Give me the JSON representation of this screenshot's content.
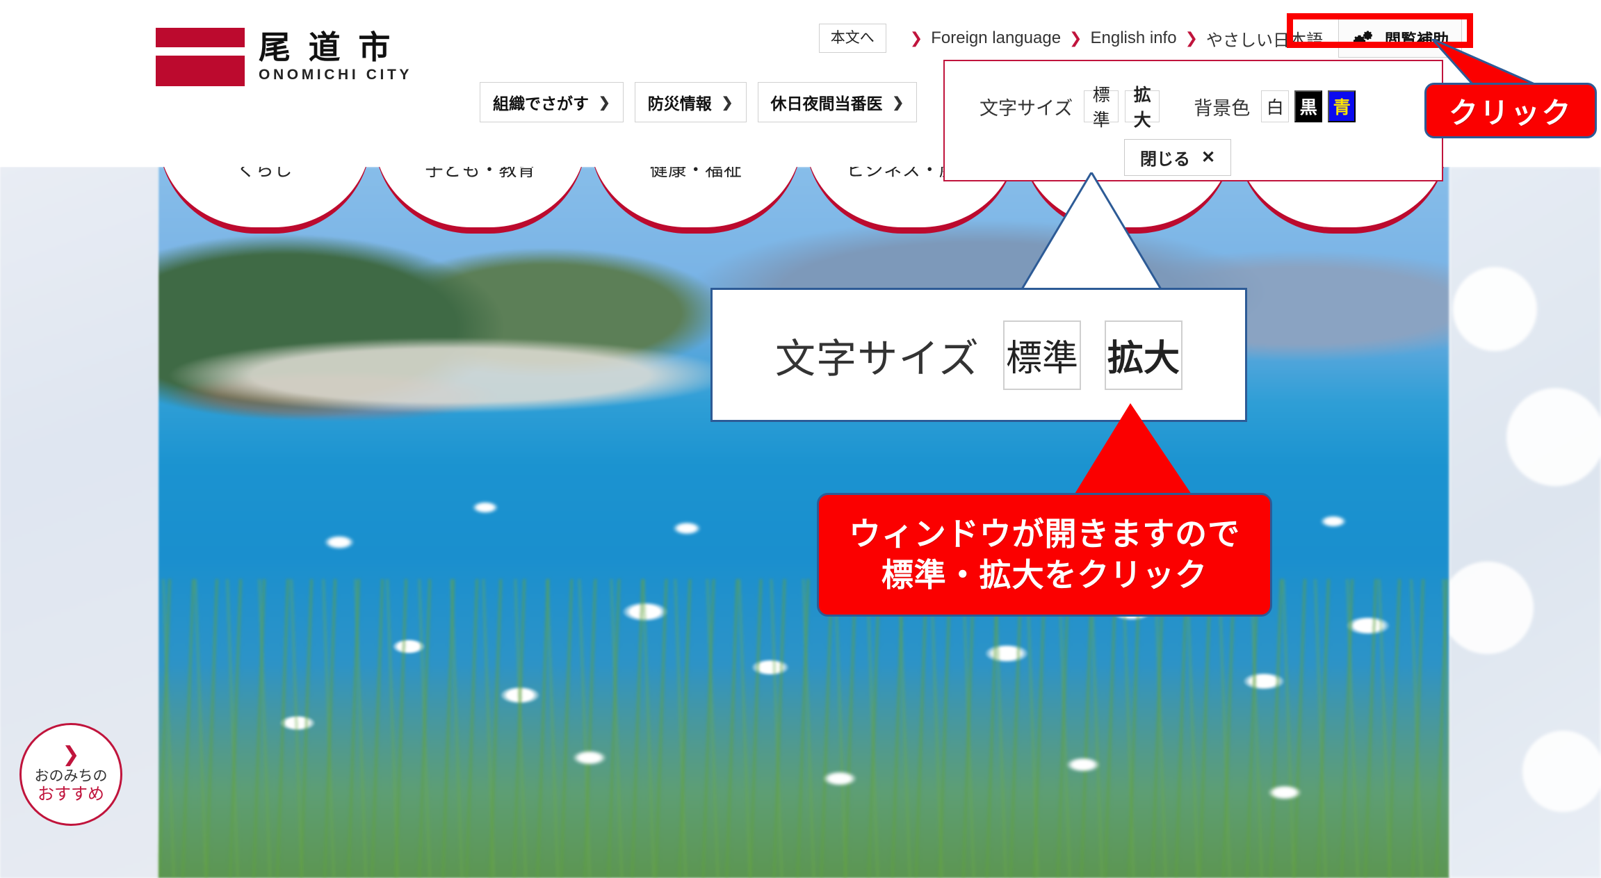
{
  "site": {
    "logo_jp": "尾 道 市",
    "logo_en": "ONOMICHI CITY"
  },
  "header": {
    "skip_link": "本文へ",
    "lang_links": [
      {
        "label": "Foreign language",
        "chevron": "❯"
      },
      {
        "label": "English info",
        "chevron": "❯"
      },
      {
        "label": "やさしい日本語",
        "chevron": "❯"
      }
    ],
    "accessibility_button": {
      "label": "閲覧補助",
      "icon": "double-gear-icon"
    },
    "sub_nav": [
      {
        "label": "組織でさがす",
        "chevron": "❯"
      },
      {
        "label": "防災情報",
        "chevron": "❯"
      },
      {
        "label": "休日夜間当番医",
        "chevron": "❯"
      }
    ]
  },
  "category_nav": [
    {
      "label": "くらし",
      "icon": "house-icon"
    },
    {
      "label": "子ども・教育",
      "icon": "parent-child-icon"
    },
    {
      "label": "健康・福祉",
      "icon": "heart-hand-icon"
    },
    {
      "label": "ビジネス・産業",
      "icon": "briefcase-icon"
    },
    {
      "label": "",
      "icon": ""
    },
    {
      "label": "",
      "icon": ""
    }
  ],
  "accessibility_panel": {
    "font_size_label": "文字サイズ",
    "font_size_options": [
      {
        "label": "標準",
        "selected": false
      },
      {
        "label": "拡大",
        "selected": true
      }
    ],
    "background_label": "背景色",
    "background_options": [
      {
        "label": "白",
        "bg": "#ffffff",
        "fg": "#222222"
      },
      {
        "label": "黒",
        "bg": "#000000",
        "fg": "#ffffff"
      },
      {
        "label": "青",
        "bg": "#0b0bef",
        "fg": "#ffe600"
      }
    ],
    "close_label": "閉じる",
    "close_icon": "✕"
  },
  "magnifier": {
    "font_size_label": "文字サイズ",
    "option_normal": "標準",
    "option_large": "拡大"
  },
  "callouts": {
    "click": "クリック",
    "instruction_line1": "ウィンドウが開きますので",
    "instruction_line2": "標準・拡大をクリック"
  },
  "recommend_badge": {
    "chevron": "❯",
    "line1": "おのみちの",
    "line2": "おすすめ"
  },
  "colors": {
    "brand_red": "#bc0a2e",
    "highlight_red": "#fb0000",
    "callout_border_blue": "#2d5b96",
    "accent_blue": "#0b0bef",
    "accent_yellow": "#ffe600"
  }
}
